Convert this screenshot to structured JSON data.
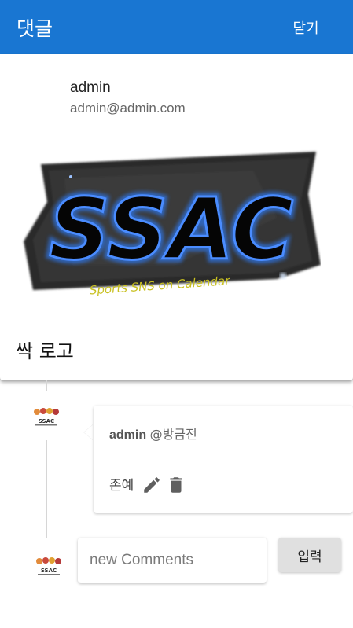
{
  "appbar": {
    "title": "댓글",
    "close_label": "닫기",
    "color": "#1976d2"
  },
  "post": {
    "author_name": "admin",
    "author_email": "admin@admin.com",
    "image_logo_text": "SSAC",
    "image_tagline": "Sports SNS on Calendar",
    "title": "싹 로고"
  },
  "comments": [
    {
      "author": "admin",
      "time": "@방금전",
      "text": "존예",
      "edit_icon": "pencil-icon",
      "delete_icon": "trash-icon"
    }
  ],
  "avatar_label": "SSAC",
  "new_comment": {
    "placeholder": "new Comments",
    "value": "",
    "submit_label": "입력"
  }
}
